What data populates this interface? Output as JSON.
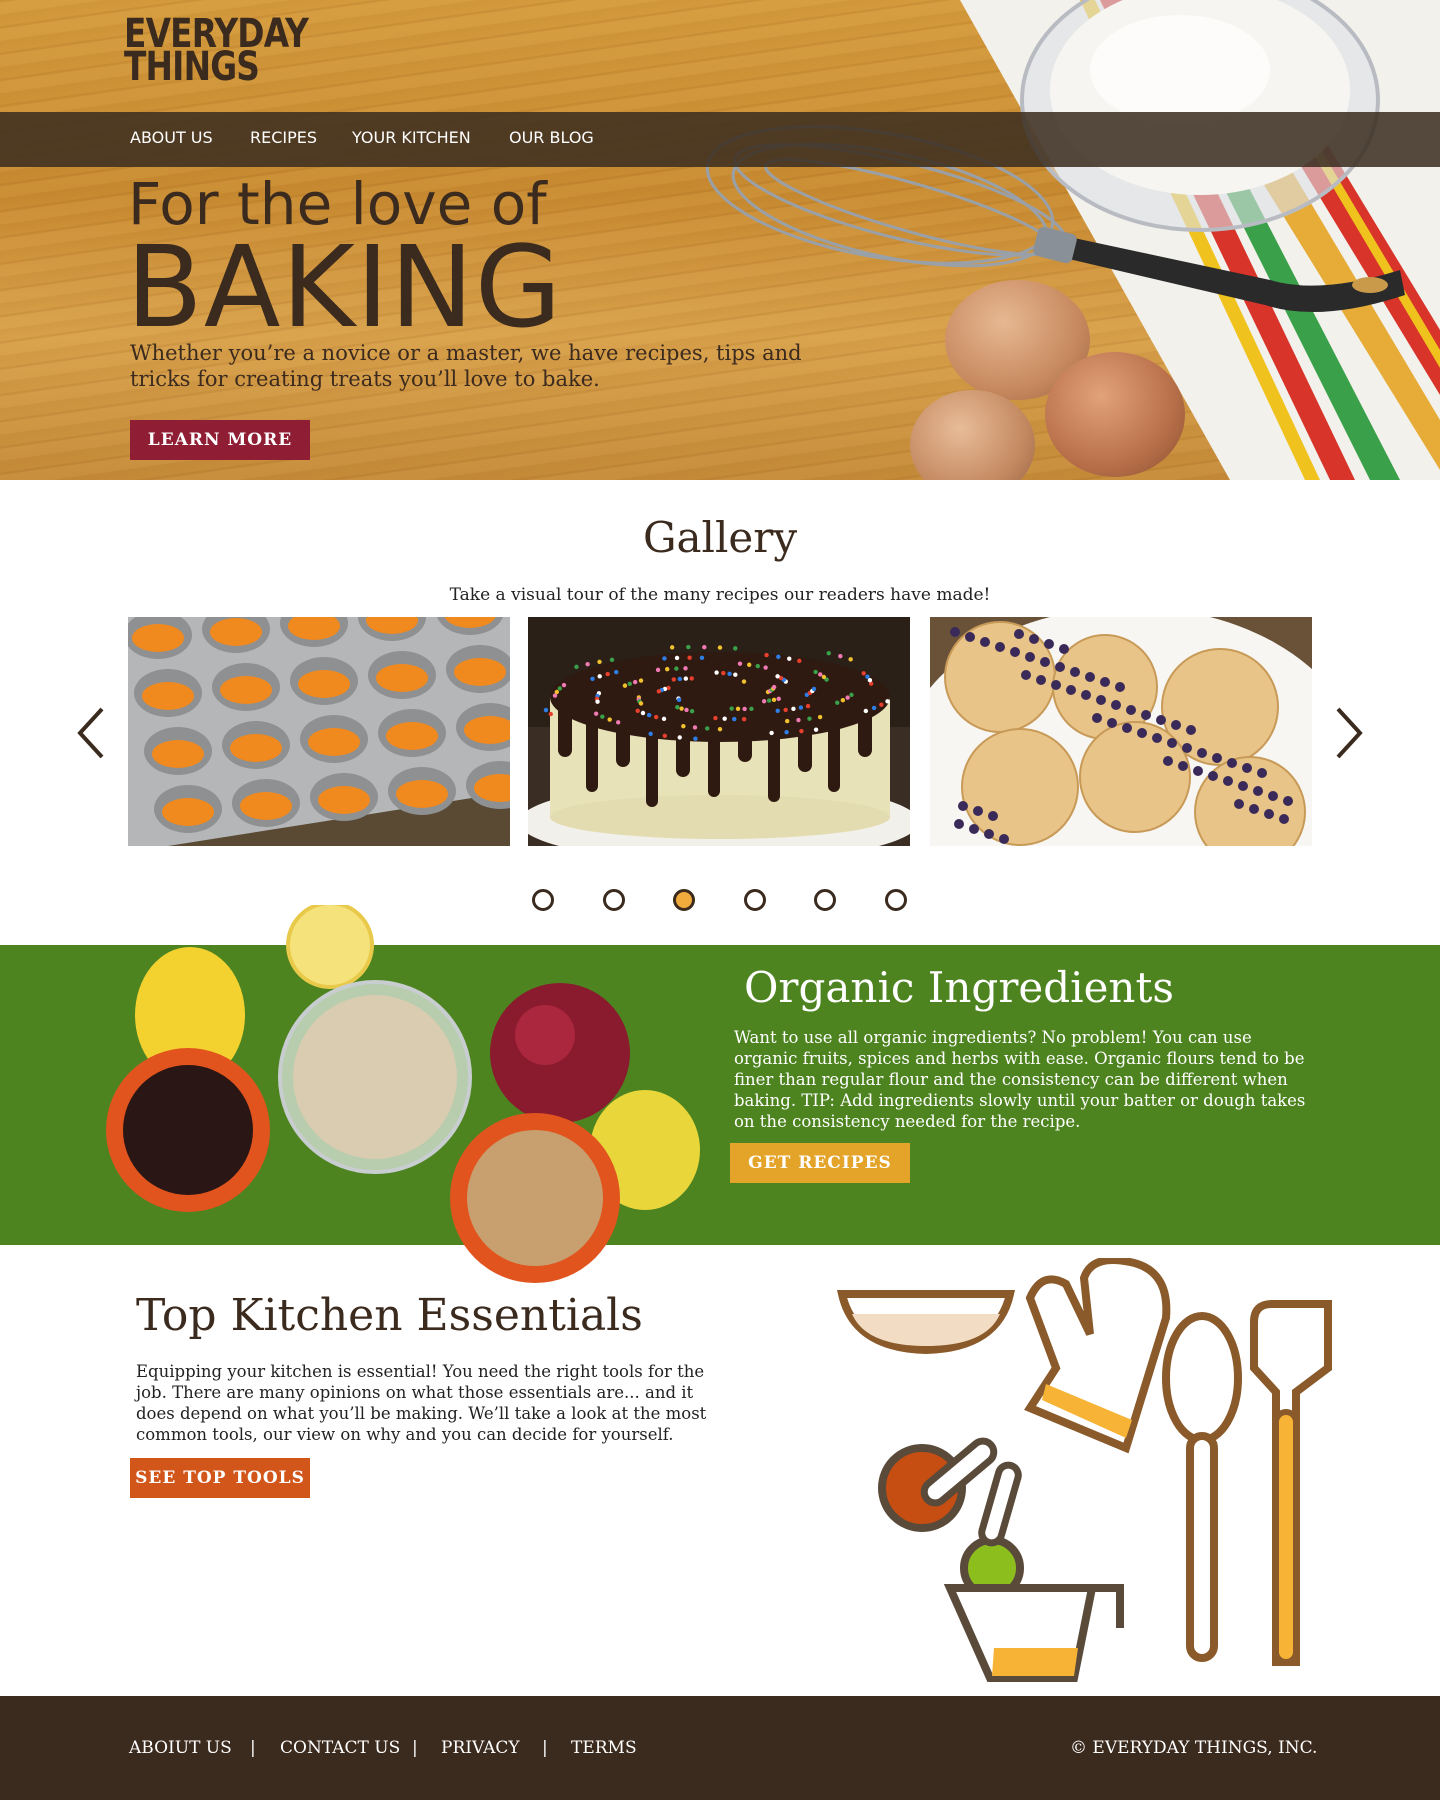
{
  "brand": {
    "line1": "EVERYDAY",
    "line2": "THINGS"
  },
  "nav": {
    "items": [
      "ABOUT US",
      "RECIPES",
      "YOUR KITCHEN",
      "OUR BLOG"
    ]
  },
  "hero": {
    "kicker": "For the love of",
    "title": "BAKING",
    "subtitle": "Whether you’re a novice or a master, we have recipes, tips and tricks for creating treats you’ll love to bake.",
    "button": "LEARN MORE"
  },
  "gallery": {
    "title": "Gallery",
    "subtitle": "Take a visual tour of the many recipes our readers have made!",
    "photos": [
      "pumpkin-mini-tarts-photo",
      "chocolate-drip-cake-photo",
      "blueberry-muffins-photo"
    ],
    "dots": 6,
    "active_dot": 3,
    "dot_color": "#f0ab3c"
  },
  "organic": {
    "title": "Organic Ingredients",
    "text": "Want to use all organic ingredients? No problem! You can use organic fruits, spices and herbs with ease. Organic flours tend to be finer than regular flour and the consistency can be different when baking. TIP: Add ingredients slowly until your batter or dough takes on the consistency needed for the recipe.",
    "button": "GET RECIPES",
    "bg_color": "#4e8420",
    "button_color": "#e4a42a"
  },
  "essentials": {
    "title": "Top Kitchen Essentials",
    "text": "Equipping your kitchen is essential! You need the right tools for the job. There are many opinions on what those essentials are... and it does depend on what you’ll be making. We’ll take a look at the most common tools, our view on why and you can decide for yourself.",
    "button": "SEE TOP TOOLS",
    "button_color": "#d2551a"
  },
  "footer": {
    "links": [
      "ABOIUT US",
      "CONTACT US",
      "PRIVACY",
      "TERMS"
    ],
    "separator": "|",
    "copyright": "© EVERYDAY THINGS, INC."
  },
  "colors": {
    "brown": "#3b2a1e",
    "crimson": "#8f1d33"
  }
}
